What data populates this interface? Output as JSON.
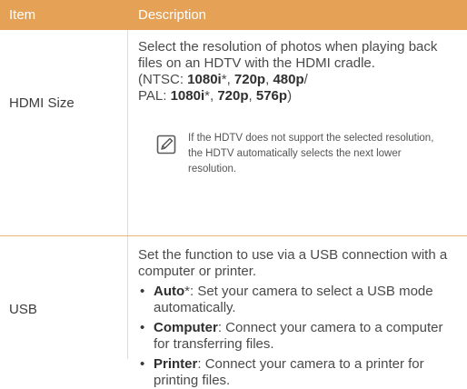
{
  "header": {
    "item": "Item",
    "description": "Description"
  },
  "hdmi": {
    "label": "HDMI Size",
    "line1": "Select the resolution of photos when playing back",
    "line2": "files on an HDTV with the HDMI cradle.",
    "ntsc_prefix": "(NTSC: ",
    "ntsc_1080i": "1080i",
    "ntsc_star": "*",
    "sep1": ", ",
    "ntsc_720p": "720p",
    "sep2": ", ",
    "ntsc_480p": "480p",
    "ntsc_suffix": "/",
    "pal_prefix": "PAL: ",
    "pal_1080i": "1080i",
    "pal_star": "*",
    "sep3": ", ",
    "pal_720p": "720p",
    "sep4": ", ",
    "pal_576p": "576p",
    "pal_suffix": ")",
    "note_icon": "note-pencil-icon",
    "note_line1": "If the HDTV does not support the selected resolution,",
    "note_line2": "the HDTV automatically selects the next lower",
    "note_line3": "resolution."
  },
  "usb": {
    "label": "USB",
    "intro_line1": "Set the function to use via a USB connection with a",
    "intro_line2": "computer or printer.",
    "bullets": [
      {
        "term": "Auto",
        "star": "*",
        "text1": ": Set your camera to select a USB mode",
        "text2": "automatically."
      },
      {
        "term": "Computer",
        "text1": ": Connect your camera to a computer",
        "text2": "for transferring files."
      },
      {
        "term": "Printer",
        "text1": ": Connect your camera to a printer for",
        "text2": "printing files."
      }
    ]
  },
  "colors": {
    "header_bg": "#e5a257",
    "divider": "#e9b479"
  }
}
